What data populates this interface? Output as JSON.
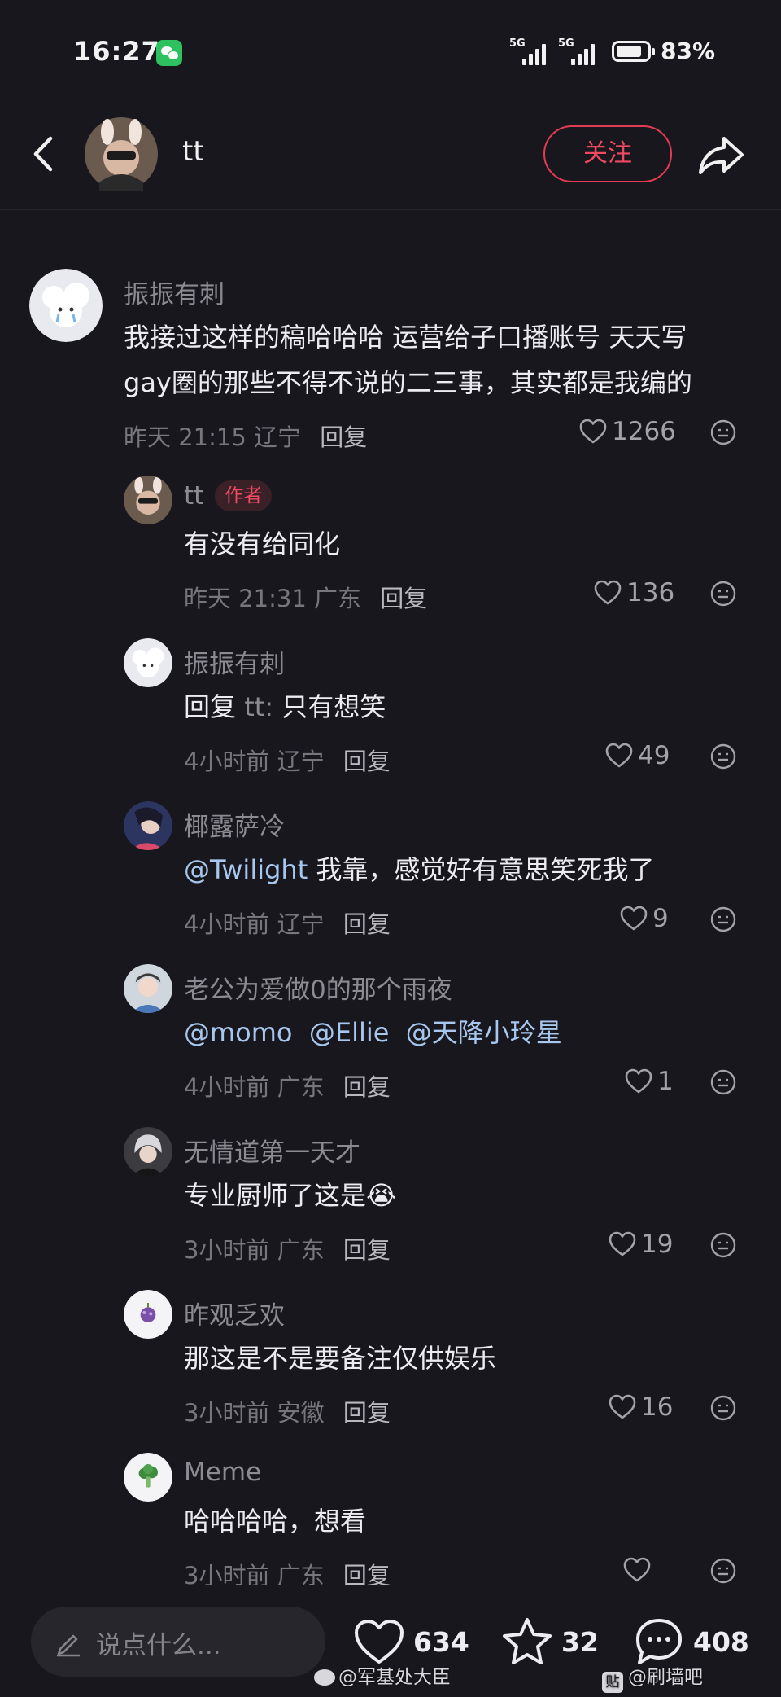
{
  "status_bar": {
    "time": "16:27",
    "net1": "5G",
    "net2": "5G",
    "battery": "83%"
  },
  "header": {
    "username": "tt",
    "follow_label": "关注"
  },
  "comments": [
    {
      "name": "振振有刺",
      "text_lines": [
        "我接过这样的稿哈哈哈 运营给子口播账号 天天写",
        "gay圈的那些不得不说的二三事，其实都是我编的"
      ],
      "time": "昨天 21:15",
      "region": "辽宁",
      "reply_label": "回复",
      "likes": "1266"
    },
    {
      "name": "tt",
      "badge": "作者",
      "text": "有没有给同化",
      "time": "昨天 21:31",
      "region": "广东",
      "reply_label": "回复",
      "likes": "136"
    },
    {
      "name": "振振有刺",
      "reply_prefix": "回复",
      "reply_target": "tt:",
      "text": "只有想笑",
      "time": "4小时前",
      "region": "辽宁",
      "reply_label": "回复",
      "likes": "49"
    },
    {
      "name": "椰露萨冷",
      "mention": "@Twilight",
      "text": "我靠，感觉好有意思笑死我了",
      "time": "4小时前",
      "region": "辽宁",
      "reply_label": "回复",
      "likes": "9"
    },
    {
      "name": "老公为爱做0的那个雨夜",
      "mentions": [
        "@momo",
        "@Ellie",
        "@天降小玲星"
      ],
      "time": "4小时前",
      "region": "广东",
      "reply_label": "回复",
      "likes": "1"
    },
    {
      "name": "无情道第一天才",
      "text": "专业厨师了这是",
      "emoji": "😭",
      "time": "3小时前",
      "region": "广东",
      "reply_label": "回复",
      "likes": "19"
    },
    {
      "name": "昨观乏欢",
      "text": "那这是不是要备注仅供娱乐",
      "time": "3小时前",
      "region": "安徽",
      "reply_label": "回复",
      "likes": "16"
    },
    {
      "name": "Meme",
      "text": "哈哈哈哈，想看",
      "time": "3小时前",
      "region": "广东",
      "reply_label": "回复",
      "likes": ""
    }
  ],
  "bottom_bar": {
    "input_placeholder": "说点什么...",
    "likes": "634",
    "favorites": "32",
    "comments": "408"
  },
  "watermarks": {
    "weibo": "@军基处大臣",
    "tieba": "@刷墙吧",
    "tieba_glyph": "贴"
  },
  "colors": {
    "background": "#18171d",
    "accent": "#e43b55",
    "mention": "#a8c7ee"
  }
}
